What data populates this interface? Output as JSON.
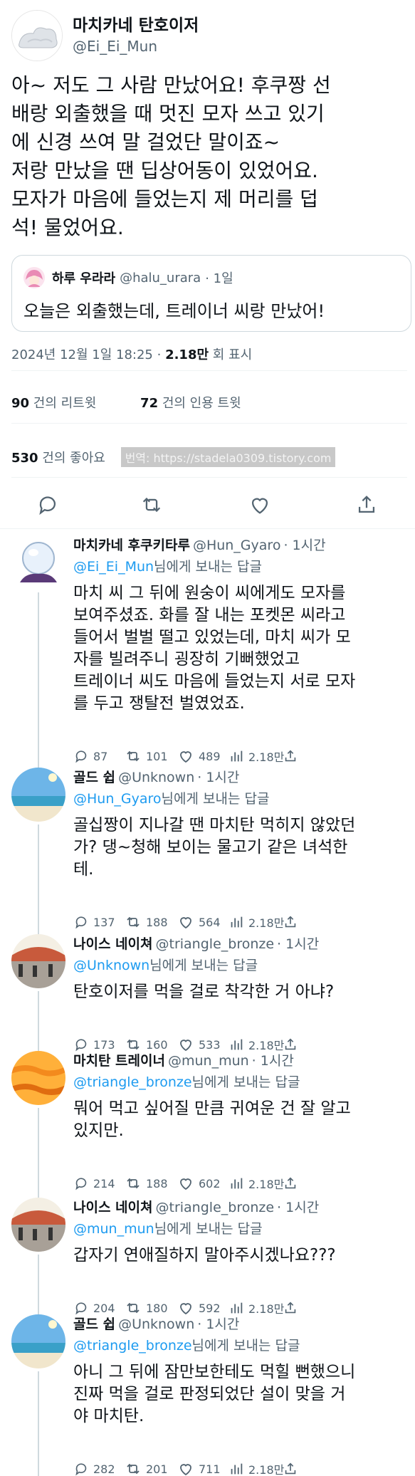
{
  "main_tweet": {
    "author_name": "마치카네 탄호이저",
    "handle": "@Ei_Ei_Mun",
    "text": "아~ 저도 그 사람 만났어요! 후쿠짱 선\n배랑 외출했을 때 멋진 모자 쓰고 있기\n에 신경 쓰여 말 걸었단 말이죠~\n저랑 만났을 땐 딥상어동이 있었어요.\n모자가 마음에 들었는지 제 머리를 덥\n석! 물었어요.",
    "quote": {
      "author_name": "하루 우라라",
      "handle": "@halu_urara",
      "time": "· 1일",
      "text": "오늘은 외출했는데, 트레이너 씨랑 만났어!"
    },
    "timestamp": "2024년 12월 1일  18:25  ·",
    "views": "2.18만",
    "views_label": " 회 표시",
    "retweets": "90",
    "retweets_label": " 건의 리트윗",
    "quotes": "72",
    "quotes_label": " 건의 인용 트윗",
    "likes": "530",
    "likes_label": " 건의 좋아요",
    "watermark": "번역: https://stadela0309.tistory.com"
  },
  "reply_suffix": "님에게 보내는 답글",
  "replies": [
    {
      "name": "마치카네 후쿠키타루",
      "handle": "@Hun_Gyaro",
      "time": "· 1시간",
      "to": "@Ei_Ei_Mun",
      "text": "마치 씨 그 뒤에 원숭이 씨에게도 모자를\n보여주셨죠. 화를 잘 내는 포켓몬 씨라고\n들어서 벌벌 떨고 있었는데, 마치 씨가 모\n자를 빌려주니 굉장히 기뻐했었고\n트레이너 씨도 마음에 들었는지 서로 모자\n를 두고 쟁탈전 벌였었죠.",
      "replies": "87",
      "retweets": "101",
      "likes": "489",
      "views": "2.18만"
    },
    {
      "name": "골드 쉽",
      "handle": "@Unknown",
      "time": "· 1시간",
      "to": "@Hun_Gyaro",
      "text": "골십짱이 지나갈 땐 마치탄 먹히지 않았던\n가? 댕~청해 보이는 물고기 같은 녀석한\n테.",
      "replies": "137",
      "retweets": "188",
      "likes": "564",
      "views": "2.18만"
    },
    {
      "name": "나이스 네이쳐",
      "handle": "@triangle_bronze",
      "time": "· 1시간",
      "to": "@Unknown",
      "text": "탄호이저를 먹을 걸로 착각한 거 아냐?",
      "replies": "173",
      "retweets": "160",
      "likes": "533",
      "views": "2.18만"
    },
    {
      "name": "마치탄 트레이너",
      "handle": "@mun_mun",
      "time": "· 1시간",
      "to": "@triangle_bronze",
      "text": "뭐어 먹고 싶어질 만큼 귀여운 건 잘 알고\n있지만.",
      "replies": "214",
      "retweets": "188",
      "likes": "602",
      "views": "2.18만"
    },
    {
      "name": "나이스 네이쳐",
      "handle": "@triangle_bronze",
      "time": "· 1시간",
      "to": "@mun_mun",
      "text": "갑자기 연애질하지 말아주시겠나요???",
      "replies": "204",
      "retweets": "180",
      "likes": "592",
      "views": "2.18만"
    },
    {
      "name": "골드 쉽",
      "handle": "@Unknown",
      "time": "· 1시간",
      "to": "@triangle_bronze",
      "text": "아니 그 뒤에 잠만보한테도 먹힐 뻔했으니\n진짜 먹을 걸로 판정되었단 설이 맞을 거\n야 마치탄.",
      "replies": "282",
      "retweets": "201",
      "likes": "711",
      "views": "2.18만"
    }
  ],
  "colors": {
    "text": "#0f1419",
    "secondary": "#536471",
    "link": "#1d9bf0",
    "border": "#cfd9de"
  },
  "icons": [
    "reply-icon",
    "retweet-icon",
    "like-icon",
    "share-icon",
    "views-icon"
  ]
}
